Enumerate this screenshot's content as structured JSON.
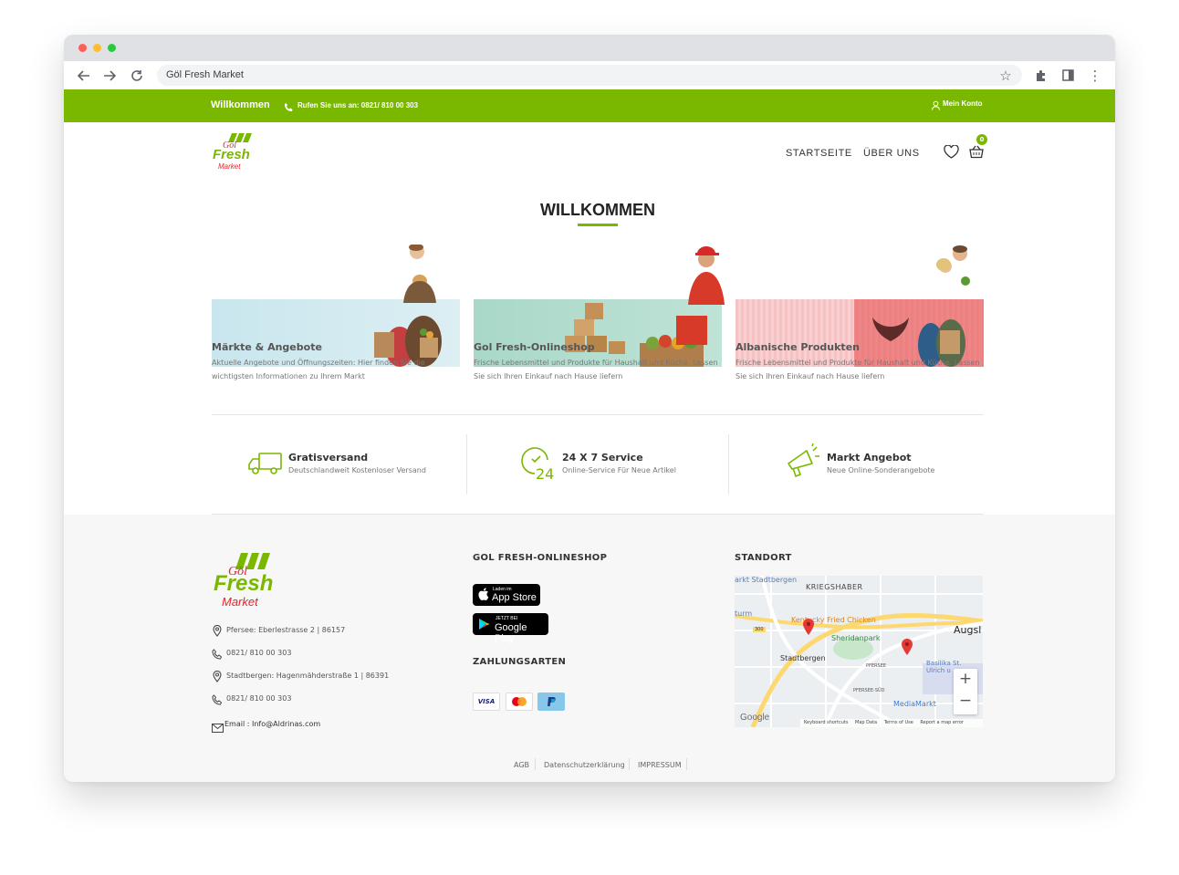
{
  "browser": {
    "url": "Göl Fresh Market",
    "back_icon": "arrow-left-icon",
    "forward_icon": "arrow-right-icon",
    "reload_icon": "reload-icon"
  },
  "topbar": {
    "welcome": "Willkommen",
    "phone": "Rufen Sie uns an: 0821/ 810 00 303",
    "account": "Mein Konto",
    "bg_color": "#7ab800"
  },
  "header": {
    "logo_top": "Göl",
    "logo_mid": "Fresh",
    "logo_bottom": "Market",
    "nav": [
      "STARTSEITE",
      "ÜBER UNS"
    ],
    "cart_count": "0"
  },
  "main": {
    "title": "WILLKOMMEN",
    "cards": [
      {
        "title": "Märkte & Angebote",
        "text": "Aktuelle Angebote und Öffnungszeiten: Hier finden Sie die wichtigsten Informationen zu Ihrem Markt"
      },
      {
        "title": "Gol Fresh-Onlineshop",
        "text": "Frische Lebensmittel und Produkte für Haushalt und Küche. Lassen Sie sich Ihren Einkauf nach Hause liefern"
      },
      {
        "title": "Albanische Produkten",
        "text": "Frische Lebensmittel und Produkte für Haushalt und Küche. Lassen Sie sich Ihren Einkauf nach Hause liefern"
      }
    ],
    "features": [
      {
        "title": "Gratisversand",
        "subtitle": "Deutschlandweit Kostenloser Versand",
        "icon": "truck-icon"
      },
      {
        "title": "24 X 7 Service",
        "subtitle": "Online-Service Für Neue Artikel",
        "icon": "clock-24-icon"
      },
      {
        "title": "Markt Angebot",
        "subtitle": "Neue Online-Sonderangebote",
        "icon": "megaphone-icon"
      }
    ]
  },
  "footer": {
    "contacts": [
      {
        "text": "Pfersee: Eberlestrasse 2 | 86157",
        "icon": "map-pin-icon"
      },
      {
        "text": "0821/ 810 00 303",
        "icon": "phone-icon"
      },
      {
        "text": "Stadtbergen: Hagenmähderstraße 1 | 86391",
        "icon": "map-pin-icon"
      },
      {
        "text": "0821/ 810 00 303",
        "icon": "phone-icon"
      },
      {
        "text": "Email : Info@Aldrinas.com",
        "icon": "mail-icon"
      }
    ],
    "shop_heading": "GOL FRESH-ONLINESHOP",
    "app_store_small": "Laden im",
    "app_store": "App Store",
    "google_play_small": "JETZT BEI",
    "google_play": "Google Play",
    "payment_heading": "ZAHLUNGSARTEN",
    "payments": [
      "VISA",
      "Mastercard",
      "PayPal"
    ],
    "location_heading": "STANDORT",
    "map": {
      "labels": [
        "arkt Stadtbergen",
        "KRIEGSHABER",
        "Kentucky Fried Chicken",
        "Sheridanpark",
        "Stadtbergen",
        "PFERSEE",
        "PFERSEE-SÜD",
        "MediaMarkt",
        "Augsl",
        "Basilika St. Ulrich u",
        "turm",
        "300"
      ],
      "attribution": [
        "Keyboard shortcuts",
        "Map Data",
        "Terms of Use",
        "Report a map error"
      ],
      "google": "Google",
      "zoom_in": "+",
      "zoom_out": "−"
    },
    "bottom_links": [
      "AGB",
      "Datenschutzerklärung",
      "IMPRESSUM"
    ]
  }
}
